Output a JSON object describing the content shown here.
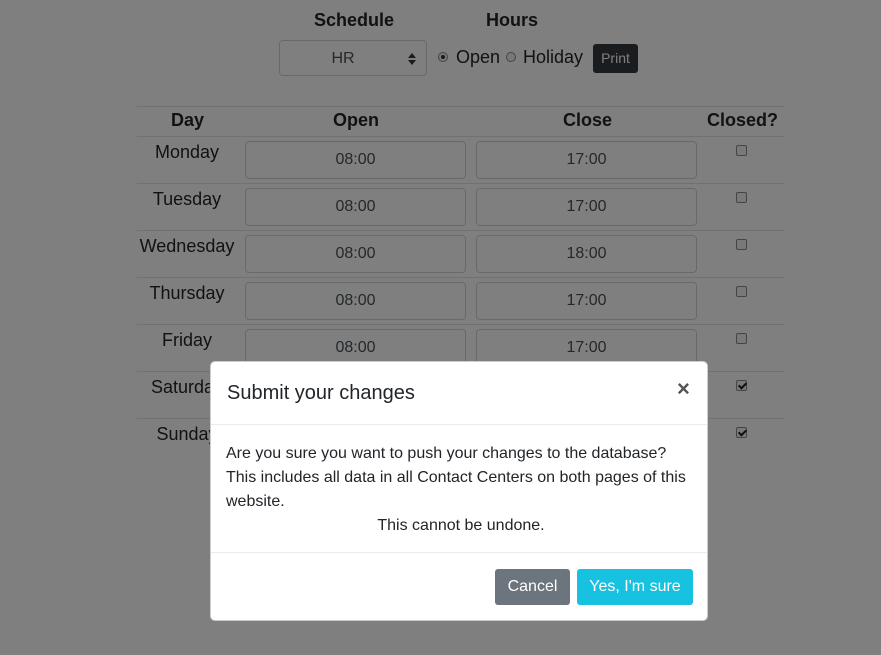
{
  "header": {
    "schedule_label": "Schedule",
    "hours_label": "Hours",
    "schedule_select_value": "HR",
    "radio_open_label": "Open",
    "radio_holiday_label": "Holiday",
    "selected_radio": "Open",
    "print_label": "Print"
  },
  "table": {
    "columns": [
      "Day",
      "Open",
      "Close",
      "Closed?"
    ],
    "rows": [
      {
        "day": "Monday",
        "open": "08:00",
        "close": "17:00",
        "closed": false
      },
      {
        "day": "Tuesday",
        "open": "08:00",
        "close": "17:00",
        "closed": false
      },
      {
        "day": "Wednesday",
        "open": "08:00",
        "close": "18:00",
        "closed": false
      },
      {
        "day": "Thursday",
        "open": "08:00",
        "close": "17:00",
        "closed": false
      },
      {
        "day": "Friday",
        "open": "08:00",
        "close": "17:00",
        "closed": false
      },
      {
        "day": "Saturday",
        "open": "",
        "close": "",
        "closed": true
      },
      {
        "day": "Sunday",
        "open": "",
        "close": "",
        "closed": true
      }
    ]
  },
  "modal": {
    "title": "Submit your changes",
    "close_icon": "×",
    "body_line1": "Are you sure you want to push your changes to the database? This includes all data in all Contact Centers on both pages of this website.",
    "body_line2": "This cannot be undone.",
    "cancel_label": "Cancel",
    "confirm_label": "Yes, I'm sure"
  },
  "colors": {
    "overlay": "#000000",
    "print_button": "#343a40",
    "cancel_button": "#6c757d",
    "confirm_button": "#17c1e0"
  }
}
